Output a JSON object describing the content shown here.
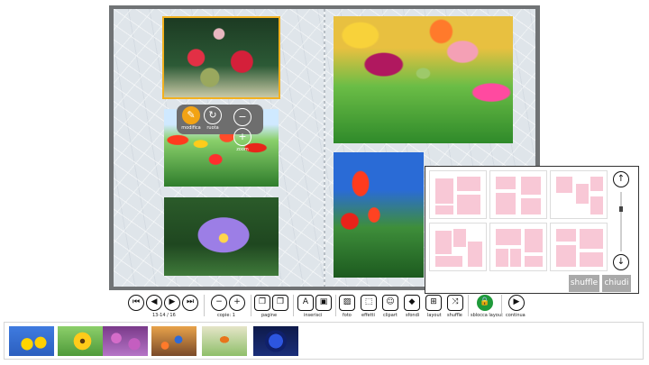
{
  "photos": [
    {
      "name": "photo-roses",
      "selected": true
    },
    {
      "name": "photo-red-tulips-field"
    },
    {
      "name": "photo-purple-water-lily"
    },
    {
      "name": "photo-colorful-tulips"
    },
    {
      "name": "photo-red-tulips-sky"
    }
  ],
  "edit_bar": {
    "edit_label": "modifica",
    "rotate_label": "ruota",
    "zoom_label": "zoom"
  },
  "layouts_popup": {
    "shuffle_label": "shuffle",
    "close_label": "chiudi",
    "layout_count": 6
  },
  "toolbar": {
    "page_range": "13-14 / 16",
    "copies_label": "copie: 1",
    "pages_label": "pagine",
    "insert_label": "inserisci",
    "photo_label": "foto",
    "effects_label": "effetti",
    "clipart_label": "clipart",
    "backgrounds_label": "sfondi",
    "layout_label": "layout",
    "shuffle_label": "shuffle",
    "unlock_layout_label": "sblocca layout",
    "continue_label": "continua"
  },
  "filmstrip": {
    "thumbs": [
      "sunflowers-sky",
      "sunflower",
      "pink-flowers",
      "blue-orange-flowers",
      "butterfly-flower",
      "blue-rose"
    ]
  },
  "colors": {
    "selection": "#f2b120",
    "lock_active": "#1f9a3a",
    "layout_cell": "#f8c8d6"
  }
}
